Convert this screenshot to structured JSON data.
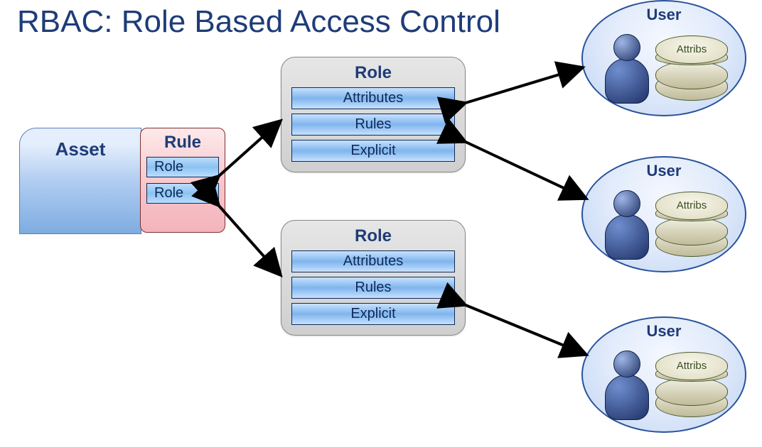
{
  "title": "RBAC: Role Based Access Control",
  "asset": {
    "label": "Asset"
  },
  "rule": {
    "label": "Rule",
    "roles": [
      "Role",
      "Role"
    ]
  },
  "roleBoxes": [
    {
      "title": "Role",
      "items": [
        "Attributes",
        "Rules",
        "Explicit"
      ]
    },
    {
      "title": "Role",
      "items": [
        "Attributes",
        "Rules",
        "Explicit"
      ]
    }
  ],
  "users": [
    {
      "label": "User",
      "attribs": "Attribs"
    },
    {
      "label": "User",
      "attribs": "Attribs"
    },
    {
      "label": "User",
      "attribs": "Attribs"
    }
  ],
  "colors": {
    "titleColor": "#1f3c78",
    "arrow": "#000000"
  }
}
